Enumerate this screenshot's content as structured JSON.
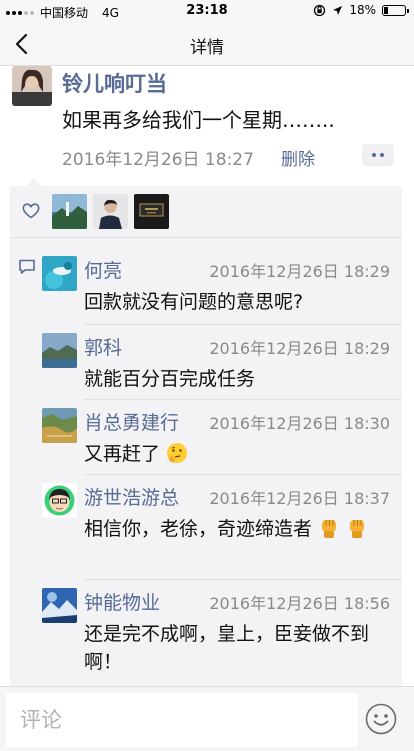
{
  "status_bar": {
    "carrier": "中国移动",
    "network": "4G",
    "time": "23:18",
    "battery": "18%",
    "battery_level": 0.18
  },
  "nav": {
    "title": "详情"
  },
  "post": {
    "author": "铃儿响叮当",
    "text": "如果再多给我们一个星期……..",
    "time": "2016年12月26日 18:27",
    "delete_label": "删除"
  },
  "comments": [
    {
      "name": "何亮",
      "time": "2016年12月26日 18:29",
      "text": "回款就没有问题的意思呢?"
    },
    {
      "name": "郭科",
      "time": "2016年12月26日 18:29",
      "text": "就能百分百完成任务"
    },
    {
      "name": "肖总勇建行",
      "time": "2016年12月26日 18:30",
      "text": "又再赶了",
      "emoji": "thinking-face"
    },
    {
      "name": "游世浩游总",
      "time": "2016年12月26日 18:37",
      "text": "相信你，老徐，奇迹缔造者",
      "emoji": "raised-fist"
    },
    {
      "name": "钟能物业",
      "time": "2016年12月26日 18:56",
      "text": "还是完不成啊，皇上，臣妾做不到啊！"
    }
  ],
  "input": {
    "placeholder": "评论"
  },
  "colors": {
    "link": "#576b95",
    "time": "#8a8a8a",
    "panel": "#f3f3f5"
  }
}
